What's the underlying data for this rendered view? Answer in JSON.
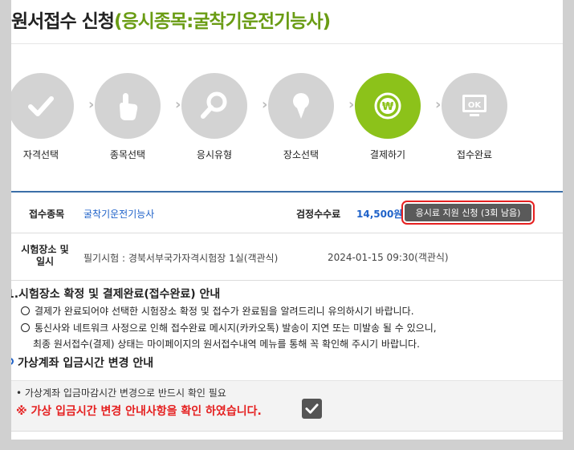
{
  "title": {
    "main": "원서접수 신청",
    "sub": "(응시종목:굴착기운전기능사)"
  },
  "steps": [
    {
      "label": "자격선택",
      "icon": "check-icon",
      "active": false
    },
    {
      "label": "종목선택",
      "icon": "hand-pointer-icon",
      "active": false
    },
    {
      "label": "응시유형",
      "icon": "magnifier-icon",
      "active": false
    },
    {
      "label": "장소선택",
      "icon": "map-pin-icon",
      "active": false
    },
    {
      "label": "결제하기",
      "icon": "won-coin-icon",
      "active": true
    },
    {
      "label": "접수완료",
      "icon": "ok-monitor-icon",
      "active": false
    }
  ],
  "info": {
    "exam_type_label": "접수종목",
    "exam_type_value": "굴착기운전기능사",
    "fee_label": "검정수수료",
    "fee_value": "14,500원",
    "fee_support_button": "응시료 지원 신청 (3회 남음)",
    "venue_label_line1": "시험장소 및",
    "venue_label_line2": "일시",
    "venue_value": "필기시험 : 경북서부국가자격시험장 1실(객관식)",
    "datetime_value": "2024-01-15 09:30(객관식)"
  },
  "notice": {
    "title": "1.시험장소 확정 및 결제완료(접수완료) 안내",
    "item1": "결제가 완료되어야 선택한 시험장소 확정 및 접수가 완료됨을 알려드리니 유의하시기 바랍니다.",
    "item2_line1": "통신사와 네트워크 사정으로 인해 접수완료 메시지(카카오톡) 발송이 지연 또는 미발송 될 수 있으니,",
    "item2_line2": "최종 원서접수(결제) 상태는 마이페이지의 원서접수내역 메뉴를 통해 꼭 확인해 주시기 바랍니다."
  },
  "virtual_account": {
    "title": "가상계좌 입금시간 변경 안내",
    "bullet": "• 가상계좌 입금마감시간 변경으로 반드시 확인 필요",
    "warning": "※ 가상 입금시간 변경 안내사항을 확인 하였습니다.",
    "checked": true
  },
  "colors": {
    "active_step": "#8cc21a",
    "inactive_step": "#d3d3d3",
    "title_accent": "#6a9c14",
    "link_blue": "#1f62c9",
    "warning_red": "#e52020",
    "highlight_border": "#e62020"
  }
}
